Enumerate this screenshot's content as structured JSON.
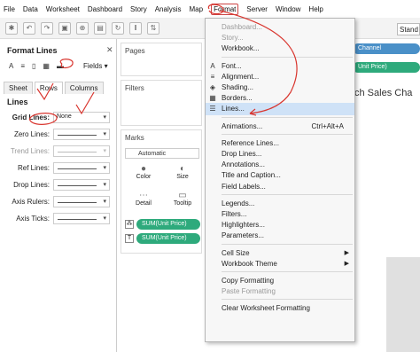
{
  "menubar": [
    "File",
    "Data",
    "Worksheet",
    "Dashboard",
    "Story",
    "Analysis",
    "Map",
    "Format",
    "Server",
    "Window",
    "Help"
  ],
  "format_pane": {
    "title": "Format Lines",
    "fields_label": "Fields",
    "icons": [
      "A",
      "≡",
      "▯",
      "▦",
      "▬"
    ],
    "tabs": [
      "Sheet",
      "Rows",
      "Columns"
    ],
    "active_tab": "Rows",
    "section": "Lines",
    "rows": [
      {
        "label": "Grid Lines:",
        "value": "None",
        "bold": true,
        "muted": false
      },
      {
        "label": "Zero Lines:",
        "value": "",
        "bold": false,
        "muted": false
      },
      {
        "label": "Trend Lines:",
        "value": "",
        "bold": false,
        "muted": true
      },
      {
        "label": "Ref Lines:",
        "value": "",
        "bold": false,
        "muted": false
      },
      {
        "label": "Drop Lines:",
        "value": "",
        "bold": false,
        "muted": false
      },
      {
        "label": "Axis Rulers:",
        "value": "",
        "bold": false,
        "muted": false
      },
      {
        "label": "Axis Ticks:",
        "value": "",
        "bold": false,
        "muted": false
      }
    ]
  },
  "cards": {
    "pages": "Pages",
    "filters": "Filters",
    "marks": "Marks",
    "mark_type": "Automatic",
    "mark_buttons": [
      {
        "label": "Color",
        "icon": "●"
      },
      {
        "label": "Size",
        "icon": "◐"
      },
      {
        "label": "Detail",
        "icon": "⋯"
      },
      {
        "label": "Tooltip",
        "icon": "▭"
      }
    ],
    "mark_pills": [
      {
        "icon": "⁂",
        "label": "SUM(Unit Price)"
      },
      {
        "icon": "T",
        "label": "SUM(Unit Price)"
      }
    ]
  },
  "canvas": {
    "title_fragment": "ch Sales Cha",
    "stand_label": "Stand",
    "columns_pill": "Channel",
    "rows_pill": "Unit Price)"
  },
  "format_menu": {
    "items": [
      {
        "label": "Dashboard...",
        "disabled": true
      },
      {
        "label": "Story...",
        "disabled": true
      },
      {
        "label": "Workbook...",
        "disabled": false
      },
      {
        "sep": true
      },
      {
        "label": "Font...",
        "icon": "A"
      },
      {
        "label": "Alignment...",
        "icon": "≡"
      },
      {
        "label": "Shading...",
        "icon": "◈"
      },
      {
        "label": "Borders...",
        "icon": "▦"
      },
      {
        "label": "Lines...",
        "icon": "☰",
        "highlight": true
      },
      {
        "sep": true
      },
      {
        "label": "Animations...",
        "shortcut": "Ctrl+Alt+A"
      },
      {
        "sep": true
      },
      {
        "label": "Reference Lines..."
      },
      {
        "label": "Drop Lines..."
      },
      {
        "label": "Annotations..."
      },
      {
        "label": "Title and Caption..."
      },
      {
        "label": "Field Labels..."
      },
      {
        "sep": true
      },
      {
        "label": "Legends..."
      },
      {
        "label": "Filters..."
      },
      {
        "label": "Highlighters..."
      },
      {
        "label": "Parameters..."
      },
      {
        "sep": true
      },
      {
        "label": "Cell Size",
        "submenu": true
      },
      {
        "label": "Workbook Theme",
        "submenu": true
      },
      {
        "sep": true
      },
      {
        "label": "Copy Formatting"
      },
      {
        "label": "Paste Formatting",
        "disabled": true
      },
      {
        "sep": true
      },
      {
        "label": "Clear Worksheet Formatting"
      }
    ]
  },
  "colors": {
    "pill_green": "#2eaa7c",
    "pill_blue": "#4a90c8",
    "annotation_red": "#d9362f",
    "highlight": "#cfe2f7"
  }
}
